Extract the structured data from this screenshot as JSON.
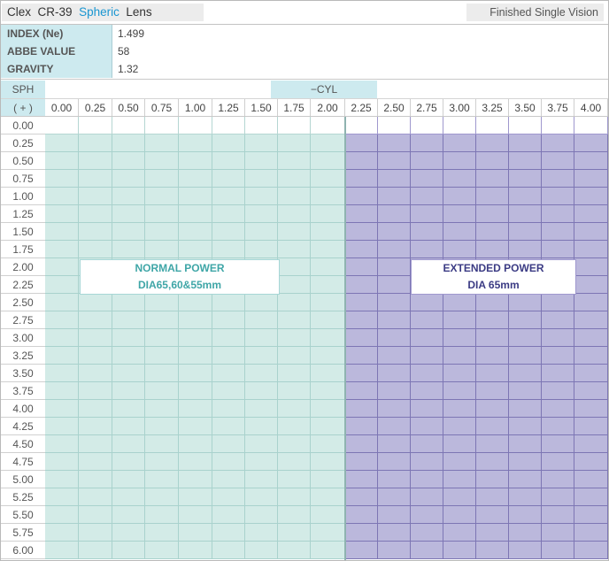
{
  "header": {
    "brand": "Clex",
    "material": "CR-39",
    "design": "Spheric",
    "product": "Lens",
    "category": "Finished Single Vision"
  },
  "properties": [
    {
      "label": "INDEX (Ne)",
      "value": "1.499"
    },
    {
      "label": "ABBE VALUE",
      "value": "58"
    },
    {
      "label": "GRAVITY",
      "value": "1.32"
    }
  ],
  "table": {
    "sph_header": "SPH",
    "sph_sign": "( + )",
    "cyl_header": "−CYL",
    "cyl_values": [
      "0.00",
      "0.25",
      "0.50",
      "0.75",
      "1.00",
      "1.25",
      "1.50",
      "1.75",
      "2.00",
      "2.25",
      "2.50",
      "2.75",
      "3.00",
      "3.25",
      "3.50",
      "3.75",
      "4.00"
    ],
    "sph_values": [
      "0.00",
      "0.25",
      "0.50",
      "0.75",
      "1.00",
      "1.25",
      "1.50",
      "1.75",
      "2.00",
      "2.25",
      "2.50",
      "2.75",
      "3.00",
      "3.25",
      "3.50",
      "3.75",
      "4.00",
      "4.25",
      "4.50",
      "4.75",
      "5.00",
      "5.25",
      "5.50",
      "5.75",
      "6.00"
    ],
    "normal_power": {
      "label": "NORMAL POWER",
      "diameter": "DIA65,60&55mm",
      "color": "#d3ebe7"
    },
    "extended_power": {
      "label": "EXTENDED POWER",
      "diameter": "DIA 65mm",
      "color": "#bbb8dc"
    },
    "availability_note": "SPH 0.00 row not available; CYL 0.00–2.00 normal power, CYL 2.25–4.00 extended power"
  }
}
